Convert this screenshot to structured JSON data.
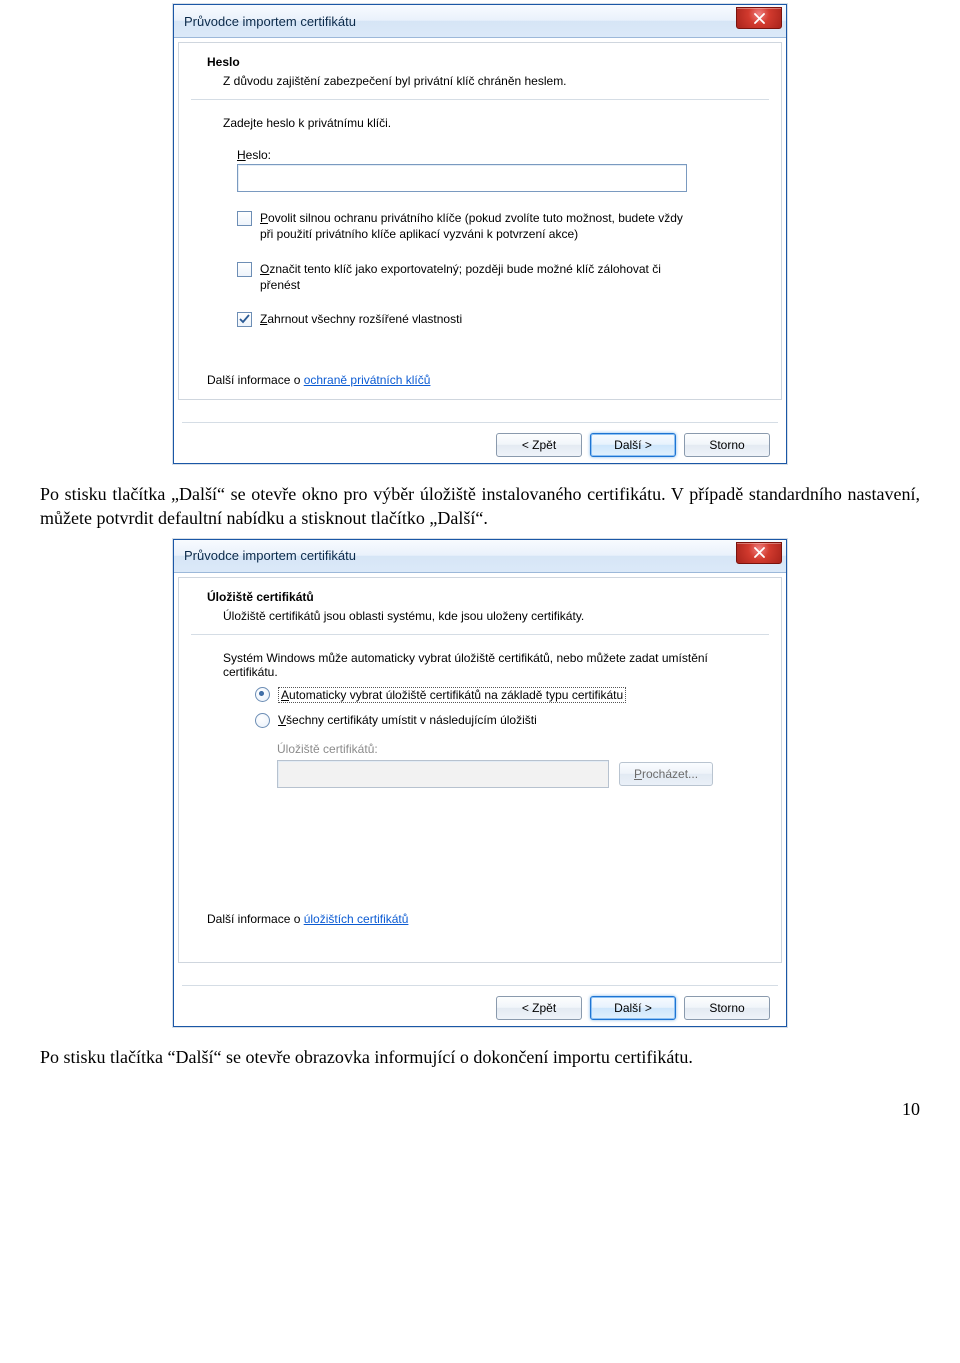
{
  "dialog1": {
    "title": "Průvodce importem certifikátu",
    "header_title": "Heslo",
    "header_sub": "Z důvodu zajištění zabezpečení byl privátní klíč chráněn heslem.",
    "instr": "Zadejte heslo k privátnímu klíči.",
    "pwd_label_pre": "H",
    "pwd_label_rest": "eslo:",
    "pwd_value": "",
    "chk1_pre": "P",
    "chk1_rest": "ovolit silnou ochranu privátního klíče (pokud zvolíte tuto možnost, budete vždy při použití privátního klíče aplikací vyzváni k potvrzení akce)",
    "chk2_pre": "O",
    "chk2_rest": "značit tento klíč jako exportovatelný; později bude možné klíč zálohovat či přenést",
    "chk3_pre": "Z",
    "chk3_rest": "ahrnout všechny rozšířené vlastnosti",
    "link_prefix": "Další informace o ",
    "link_text": "ochraně privátních klíčů",
    "btn_back": "< Zpět",
    "btn_next": "Další >",
    "btn_cancel": "Storno"
  },
  "para1": "Po stisku tlačítka „Další“ se otevře okno pro výběr úložiště instalovaného certifikátu. V případě standardního nastavení, můžete potvrdit defaultní nabídku a stisknout tlačítko „Další“.",
  "dialog2": {
    "title": "Průvodce importem certifikátu",
    "header_title": "Úložiště certifikátů",
    "header_sub": "Úložiště certifikátů jsou oblasti systému, kde jsou uloženy certifikáty.",
    "instr": "Systém Windows může automaticky vybrat úložiště certifikátů, nebo můžete zadat umístění certifikátu.",
    "radio1_pre": "A",
    "radio1_rest": "utomaticky vybrat úložiště certifikátů na základě typu certifikátu",
    "radio2_pre": "V",
    "radio2_rest": "šechny certifikáty umístit v následujícím úložišti",
    "store_label": "Úložiště certifikátů:",
    "browse": "Procházet...",
    "link_prefix": "Další informace o ",
    "link_text": "úložištích certifikátů",
    "btn_back": "< Zpět",
    "btn_next": "Další >",
    "btn_cancel": "Storno"
  },
  "para2": "Po stisku tlačítka “Další“ se otevře obrazovka informující o dokončení importu certifikátu.",
  "page_number": "10"
}
